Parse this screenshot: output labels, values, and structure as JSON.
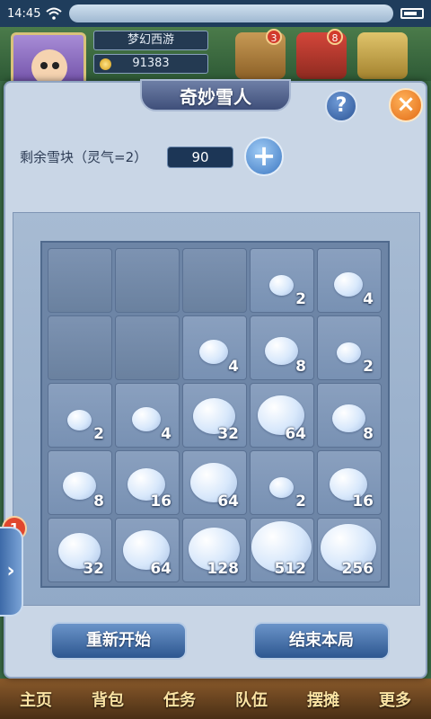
{
  "status_bar": {
    "time": "14:45"
  },
  "hud": {
    "player_name": "梦幻西游",
    "gold": "91383",
    "badges": [
      "3",
      "8"
    ]
  },
  "dialog": {
    "title": "奇妙雪人",
    "help_label": "?",
    "close_label": "×",
    "remaining_label": "剩余雪块（灵气=2）",
    "remaining_value": "90",
    "plus_label": "+"
  },
  "board": {
    "rows": [
      [
        "",
        "",
        "",
        "2",
        "4"
      ],
      [
        "",
        "",
        "4",
        "8",
        "2"
      ],
      [
        "2",
        "4",
        "32",
        "64",
        "8"
      ],
      [
        "8",
        "16",
        "64",
        "2",
        "16"
      ],
      [
        "32",
        "64",
        "128",
        "512",
        "256"
      ]
    ]
  },
  "buttons": {
    "restart": "重新开始",
    "end": "结束本局"
  },
  "side_tab": {
    "badge": "1",
    "arrow": "›"
  },
  "tabbar": {
    "items": [
      "主页",
      "背包",
      "任务",
      "队伍",
      "摆摊",
      "更多"
    ]
  },
  "colors": {
    "panel": "#c9d6e6",
    "accent": "#2d5790",
    "close": "#e26b15"
  }
}
